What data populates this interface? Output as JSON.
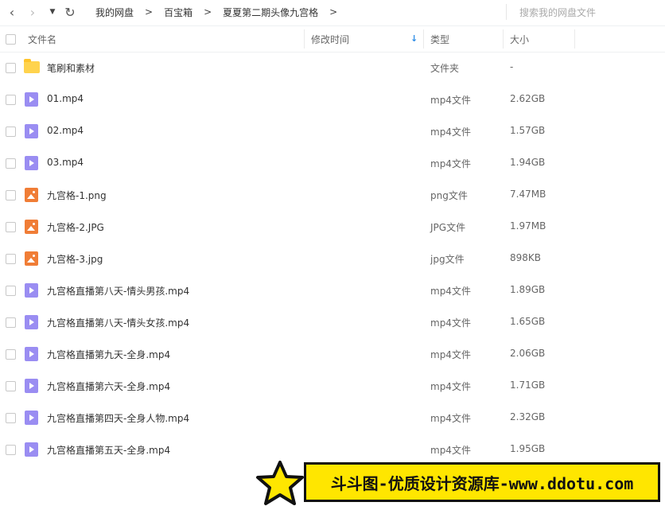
{
  "nav": {
    "back_glyph": "‹",
    "forward_glyph": "›",
    "dropdown_glyph": "▼",
    "refresh_glyph": "↻"
  },
  "breadcrumb": {
    "items": [
      "我的网盘",
      "百宝箱",
      "夏夏第二期头像九宫格"
    ],
    "separator": ">"
  },
  "search": {
    "placeholder": "搜索我的网盘文件"
  },
  "columns": {
    "name": "文件名",
    "modified": "修改时间",
    "type": "类型",
    "size": "大小",
    "sort_glyph": "↓"
  },
  "files": [
    {
      "icon": "folder-icon",
      "name": "笔刷和素材",
      "type": "文件夹",
      "size": "-"
    },
    {
      "icon": "video-file-icon",
      "name": "01.mp4",
      "type": "mp4文件",
      "size": "2.62GB"
    },
    {
      "icon": "video-file-icon",
      "name": "02.mp4",
      "type": "mp4文件",
      "size": "1.57GB"
    },
    {
      "icon": "video-file-icon",
      "name": "03.mp4",
      "type": "mp4文件",
      "size": "1.94GB"
    },
    {
      "icon": "image-file-icon",
      "name": "九宫格-1.png",
      "type": "png文件",
      "size": "7.47MB"
    },
    {
      "icon": "image-file-icon",
      "name": "九宫格-2.JPG",
      "type": "JPG文件",
      "size": "1.97MB"
    },
    {
      "icon": "image-file-icon",
      "name": "九宫格-3.jpg",
      "type": "jpg文件",
      "size": "898KB"
    },
    {
      "icon": "video-file-icon",
      "name": "九宫格直播第八天-情头男孩.mp4",
      "type": "mp4文件",
      "size": "1.89GB"
    },
    {
      "icon": "video-file-icon",
      "name": "九宫格直播第八天-情头女孩.mp4",
      "type": "mp4文件",
      "size": "1.65GB"
    },
    {
      "icon": "video-file-icon",
      "name": "九宫格直播第九天-全身.mp4",
      "type": "mp4文件",
      "size": "2.06GB"
    },
    {
      "icon": "video-file-icon",
      "name": "九宫格直播第六天-全身.mp4",
      "type": "mp4文件",
      "size": "1.71GB"
    },
    {
      "icon": "video-file-icon",
      "name": "九宫格直播第四天-全身人物.mp4",
      "type": "mp4文件",
      "size": "2.32GB"
    },
    {
      "icon": "video-file-icon",
      "name": "九宫格直播第五天-全身.mp4",
      "type": "mp4文件",
      "size": "1.95GB"
    }
  ],
  "watermark": {
    "text": "斗斗图-优质设计资源库-www.ddotu.com"
  },
  "colors": {
    "accent": "#2e8de6",
    "folder": "#ffd34d",
    "video_icon": "#9a8df2",
    "image_icon": "#f07d36",
    "banner": "#ffe600"
  }
}
